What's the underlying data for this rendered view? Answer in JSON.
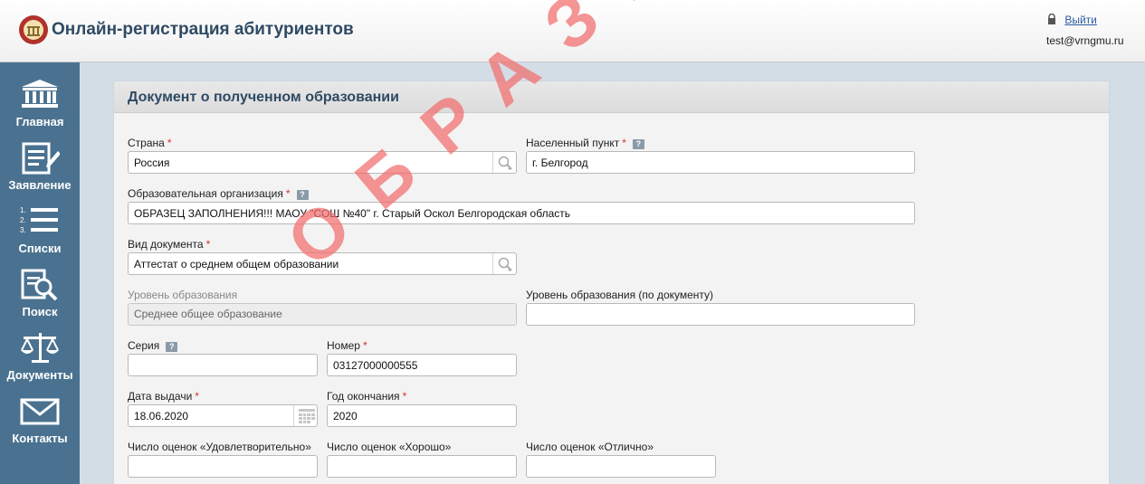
{
  "header": {
    "title": "Онлайн-регистрация абитуриентов",
    "logout_label": "Выйти",
    "user_email": "test@vrngmu.ru",
    "logo_icon": "university-seal-icon",
    "lock_icon": "lock-icon"
  },
  "sidebar": {
    "items": [
      {
        "label": "Главная",
        "icon": "building-columns-icon"
      },
      {
        "label": "Заявление",
        "icon": "document-pen-icon"
      },
      {
        "label": "Списки",
        "icon": "numbered-list-icon"
      },
      {
        "label": "Поиск",
        "icon": "document-search-icon"
      },
      {
        "label": "Документы",
        "icon": "scales-icon"
      },
      {
        "label": "Контакты",
        "icon": "envelope-icon"
      }
    ]
  },
  "panel": {
    "title": "Документ о полученном образовании",
    "required_mark": "*",
    "help_mark": "?",
    "fields": {
      "country": {
        "label": "Страна",
        "value": "Россия"
      },
      "locality": {
        "label": "Населенный пункт",
        "value": "г. Белгород"
      },
      "organization": {
        "label": "Образовательная организация",
        "value": "ОБРАЗЕЦ ЗАПОЛНЕНИЯ!!! МАОУ \"СОШ №40\" г. Старый Оскол Белгородская область"
      },
      "doc_type": {
        "label": "Вид документа",
        "value": "Аттестат о среднем общем образовании"
      },
      "edu_level": {
        "label": "Уровень образования",
        "value": "Среднее общее образование"
      },
      "edu_level_doc": {
        "label": "Уровень образования (по документу)",
        "value": ""
      },
      "series": {
        "label": "Серия",
        "value": ""
      },
      "number": {
        "label": "Номер",
        "value": "03127000000555"
      },
      "issue_date": {
        "label": "Дата выдачи",
        "value": "18.06.2020"
      },
      "grad_year": {
        "label": "Год окончания",
        "value": "2020"
      },
      "grades_satisfactory": {
        "label": "Число оценок «Удовлетворительно»",
        "value": ""
      },
      "grades_good": {
        "label": "Число оценок «Хорошо»",
        "value": ""
      },
      "grades_excellent": {
        "label": "Число оценок «Отлично»",
        "value": ""
      }
    },
    "watermark": "ОБРАЗЕЦ"
  },
  "colors": {
    "sidebar_bg": "#4a7290",
    "title_color": "#2f4a63",
    "required_color": "#d9302c",
    "watermark_color": "#f26d6d",
    "link_color": "#2c5aa0"
  }
}
